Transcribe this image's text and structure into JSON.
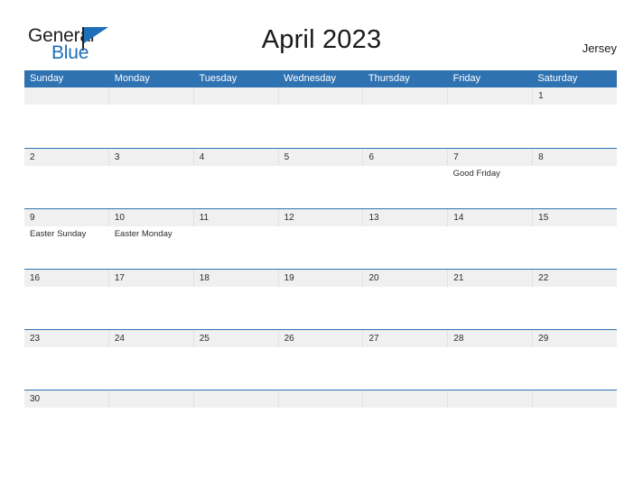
{
  "logo": {
    "word_one": "General",
    "word_two": "Blue",
    "flag_icon": "flag-triangle-icon",
    "brand_blue": "#1e6fb8",
    "brand_dark": "#231f20"
  },
  "header": {
    "title": "April 2023",
    "region": "Jersey"
  },
  "calendar": {
    "header_blue": "#2f72b2",
    "band_gray": "#f0f0f0",
    "weekdays": [
      "Sunday",
      "Monday",
      "Tuesday",
      "Wednesday",
      "Thursday",
      "Friday",
      "Saturday"
    ],
    "weeks": [
      [
        {
          "day": "",
          "event": ""
        },
        {
          "day": "",
          "event": ""
        },
        {
          "day": "",
          "event": ""
        },
        {
          "day": "",
          "event": ""
        },
        {
          "day": "",
          "event": ""
        },
        {
          "day": "",
          "event": ""
        },
        {
          "day": "1",
          "event": ""
        }
      ],
      [
        {
          "day": "2",
          "event": ""
        },
        {
          "day": "3",
          "event": ""
        },
        {
          "day": "4",
          "event": ""
        },
        {
          "day": "5",
          "event": ""
        },
        {
          "day": "6",
          "event": ""
        },
        {
          "day": "7",
          "event": "Good Friday"
        },
        {
          "day": "8",
          "event": ""
        }
      ],
      [
        {
          "day": "9",
          "event": "Easter Sunday"
        },
        {
          "day": "10",
          "event": "Easter Monday"
        },
        {
          "day": "11",
          "event": ""
        },
        {
          "day": "12",
          "event": ""
        },
        {
          "day": "13",
          "event": ""
        },
        {
          "day": "14",
          "event": ""
        },
        {
          "day": "15",
          "event": ""
        }
      ],
      [
        {
          "day": "16",
          "event": ""
        },
        {
          "day": "17",
          "event": ""
        },
        {
          "day": "18",
          "event": ""
        },
        {
          "day": "19",
          "event": ""
        },
        {
          "day": "20",
          "event": ""
        },
        {
          "day": "21",
          "event": ""
        },
        {
          "day": "22",
          "event": ""
        }
      ],
      [
        {
          "day": "23",
          "event": ""
        },
        {
          "day": "24",
          "event": ""
        },
        {
          "day": "25",
          "event": ""
        },
        {
          "day": "26",
          "event": ""
        },
        {
          "day": "27",
          "event": ""
        },
        {
          "day": "28",
          "event": ""
        },
        {
          "day": "29",
          "event": ""
        }
      ],
      [
        {
          "day": "30",
          "event": ""
        },
        {
          "day": "",
          "event": ""
        },
        {
          "day": "",
          "event": ""
        },
        {
          "day": "",
          "event": ""
        },
        {
          "day": "",
          "event": ""
        },
        {
          "day": "",
          "event": ""
        },
        {
          "day": "",
          "event": ""
        }
      ]
    ]
  }
}
